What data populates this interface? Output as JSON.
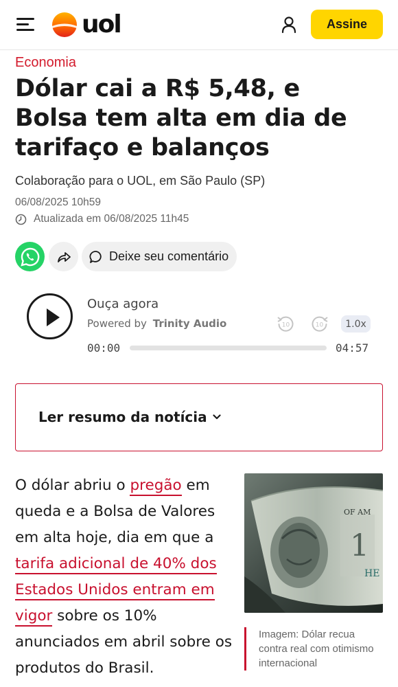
{
  "header": {
    "logo_text": "uol",
    "subscribe_label": "Assine"
  },
  "article": {
    "section": "Economia",
    "headline": "Dólar cai a R$ 5,48, e Bolsa tem alta em dia de tarifaço e balanços",
    "byline": "Colaboração para o UOL, em São Paulo (SP)",
    "published": "06/08/2025 10h59",
    "updated": "Atualizada em 06/08/2025 11h45"
  },
  "share": {
    "comment_label": "Deixe seu comentário"
  },
  "audio": {
    "listen_label": "Ouça agora",
    "powered_prefix": "Powered by",
    "provider": "Trinity Audio",
    "rewind_seconds": "10",
    "forward_seconds": "10",
    "speed": "1.0x",
    "current_time": "00:00",
    "total_time": "04:57",
    "progress": 0
  },
  "summary": {
    "label": "Ler resumo da notícia"
  },
  "body": {
    "p1_a": "O dólar abriu o ",
    "p1_link1": "pregão",
    "p1_b": " em queda e a Bolsa de Valores em alta hoje, dia em que a ",
    "p1_link2": "tarifa adicional de 40% dos Estados Unidos entram em vigor",
    "p1_c": " sobre os 10% anunciados em abril sobre os produtos do Brasil."
  },
  "image": {
    "caption": "Imagem: Dólar recua contra real com otimismo internacional"
  },
  "colors": {
    "brand_red": "#c8102e",
    "subscribe_yellow": "#ffd500",
    "whatsapp_green": "#25d366"
  }
}
